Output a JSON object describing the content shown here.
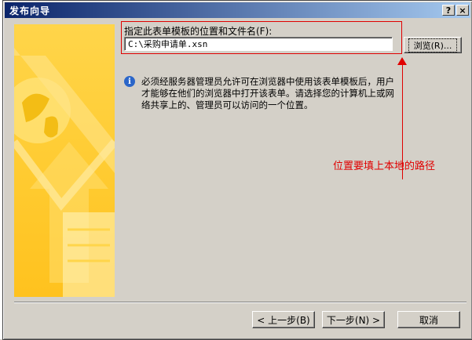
{
  "window": {
    "title": "发布向导",
    "help_label": "?",
    "close_label": "×"
  },
  "location": {
    "label": "指定此表单模板的位置和文件名(F):",
    "value": "C:\\采购申请单.xsn",
    "browse_label": "浏览(R)..."
  },
  "info": {
    "icon": "info-icon",
    "glyph": "i",
    "text": "必须经服务器管理员允许可在浏览器中使用该表单模板后，用户才能够在他们的浏览器中打开该表单。请选择您的计算机上或网络共享上的、管理员可以访问的一个位置。"
  },
  "annotation": {
    "text": "位置要填上本地的路径",
    "color": "#e00000"
  },
  "buttons": {
    "back": "< 上一步(B)",
    "next": "下一步(N) >",
    "cancel": "取消"
  },
  "colors": {
    "titlebar_start": "#0a246a",
    "titlebar_end": "#a6caf0",
    "banner": "#ffcc33"
  }
}
